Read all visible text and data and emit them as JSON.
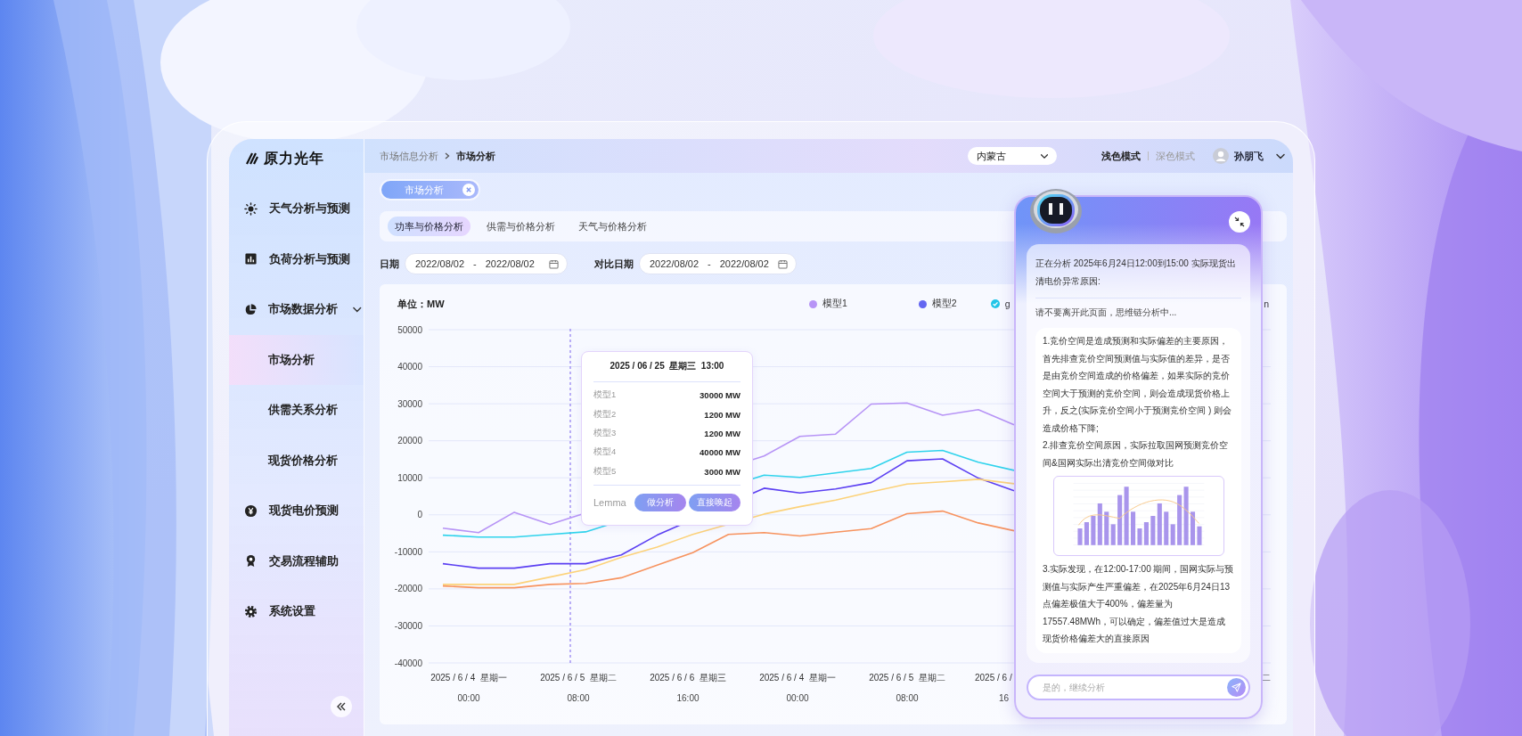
{
  "logo": {
    "text": "原力光年"
  },
  "sidebar": {
    "items": [
      {
        "label": "天气分析与预测",
        "selected": false
      },
      {
        "label": "负荷分析与预测",
        "selected": false
      },
      {
        "label": "市场数据分析",
        "selected": false,
        "expanded": true,
        "children": [
          {
            "label": "市场分析",
            "selected": true
          },
          {
            "label": "供需关系分析",
            "selected": false
          },
          {
            "label": "现货价格分析",
            "selected": false
          }
        ]
      },
      {
        "label": "现货电价预测",
        "selected": false
      },
      {
        "label": "交易流程辅助",
        "selected": false
      },
      {
        "label": "系统设置",
        "selected": false
      }
    ]
  },
  "header": {
    "breadcrumb": [
      "市场信息分析",
      "市场分析"
    ],
    "region": {
      "value": "内蒙古"
    },
    "theme_modes": [
      {
        "label": "浅色模式",
        "selected": true
      },
      {
        "label": "深色模式",
        "selected": false
      }
    ],
    "user": {
      "name": "孙朋飞"
    }
  },
  "tags": [
    {
      "label": "市场分析",
      "selected": true
    }
  ],
  "tabs": [
    {
      "label": "功率与价格分析",
      "selected": true
    },
    {
      "label": "供需与价格分析",
      "selected": false
    },
    {
      "label": "天气与价格分析",
      "selected": false
    }
  ],
  "filters": [
    {
      "label": "日期",
      "start": "2022/08/02",
      "separator": "-",
      "end": "2022/08/02"
    },
    {
      "label": "对比日期",
      "start": "2022/08/02",
      "separator": "-",
      "end": "2022/08/02"
    }
  ],
  "chart": {
    "unit": "单位：MW",
    "legend": [
      {
        "kind": "dot",
        "label": "模型1",
        "color": "#b794f6"
      },
      {
        "kind": "dot",
        "label": "模型2",
        "color": "#6366f1"
      },
      {
        "kind": "check",
        "label": "g",
        "color": "#22c5e8"
      },
      {
        "kind": "fragment",
        "label": "n"
      }
    ],
    "x_labels": [
      {
        "kind": "full",
        "date": "2025 / 6 / 4  星期一",
        "time": "00:00"
      },
      {
        "kind": "full",
        "date": "2025 / 6 / 5  星期二",
        "time": "08:00"
      },
      {
        "kind": "full",
        "date": "2025 / 6 / 6  星期三",
        "time": "16:00"
      },
      {
        "kind": "full",
        "date": "2025 / 6 / 4  星期一",
        "time": "00:00"
      },
      {
        "kind": "full",
        "date": "2025 / 6 / 5  星期二",
        "time": "08:00"
      },
      {
        "kind": "cut_right",
        "date": "2025 / 6 /",
        "time": "16"
      },
      {
        "kind": "hidden"
      },
      {
        "kind": "cut_left",
        "date": "二"
      }
    ],
    "chart_data": {
      "type": "line",
      "grid": true,
      "ylim": [
        -40000,
        50000
      ],
      "yticks": [
        50000,
        40000,
        30000,
        20000,
        10000,
        0,
        -10000,
        -20000,
        -30000,
        -40000
      ],
      "series": [
        {
          "color": "#b794f6",
          "values": [
            -3600,
            -4800,
            700,
            -2600,
            null,
            null,
            null,
            null,
            null,
            15900,
            21200,
            21800,
            29900,
            30200,
            26900,
            28400,
            24300
          ]
        },
        {
          "color": "#2fd3ec",
          "values": [
            -5500,
            -6000,
            -6000,
            -5300,
            -4600,
            null,
            null,
            null,
            null,
            10700,
            10100,
            11300,
            12500,
            16900,
            17400,
            14200,
            12000
          ]
        },
        {
          "color": "#5b3ff2",
          "values": [
            -13200,
            -14400,
            -14400,
            -13200,
            -13200,
            -10800,
            -5500,
            null,
            null,
            7200,
            5900,
            7000,
            8700,
            14600,
            15100,
            9900,
            6500
          ]
        },
        {
          "color": "#fcd27a",
          "values": [
            -18800,
            -18800,
            -18800,
            -16800,
            -14800,
            -11500,
            -8700,
            -5300,
            null,
            200,
            2200,
            4000,
            6200,
            8300,
            8900,
            9600,
            8400
          ]
        },
        {
          "color": "#f7935f",
          "values": [
            -19200,
            -19700,
            -19700,
            -18800,
            -18500,
            -17000,
            -13600,
            -10200,
            -5300,
            -4800,
            -5700,
            -4700,
            -3700,
            300,
            1000,
            -2200,
            -4300
          ]
        }
      ]
    },
    "tooltip": {
      "title": "2025 / 06 / 25  星期三  13:00",
      "rows": [
        {
          "label": "模型1",
          "value": "30000 MW"
        },
        {
          "label": "模型2",
          "value": "1200 MW"
        },
        {
          "label": "模型3",
          "value": "1200 MW"
        },
        {
          "label": "模型4",
          "value": "40000 MW"
        },
        {
          "label": "模型5",
          "value": "3000 MW"
        }
      ],
      "brand": "Lemma",
      "buttons": [
        "做分析",
        "直接唤起"
      ]
    }
  },
  "chat": {
    "status": "正在分析 2025年6月24日12:00到15:00 实际现货出清电价异常原因:",
    "notice": "请不要离开此页面，思维链分析中...",
    "answer_before": [
      "1.竞价空间是造成预测和实际偏差的主要原因，首先排查竞价空间预测值与实际值的差异，是否是由竞价空间造成的价格偏差，如果实际的竞价空间大于预测的竞价空间，则会造成现货价格上升，反之(实际竞价空间小于预测竞价空间 ) 则会造成价格下降;",
      "2.排查竞价空间原因，实际拉取国网预测竞价空间&国网实际出清竞价空间做对比"
    ],
    "answer_after": [
      "3.实际发现，在12:00-17:00 期间，国网实际与预测值与实际产生严重偏差，在2025年6月24日13点偏差极值大于400%，偏差量为17557.48MWh，可以确定，偏差值过大是造成现货价格偏差大的直接原因"
    ],
    "input": {
      "placeholder": "是的，继续分析"
    }
  }
}
